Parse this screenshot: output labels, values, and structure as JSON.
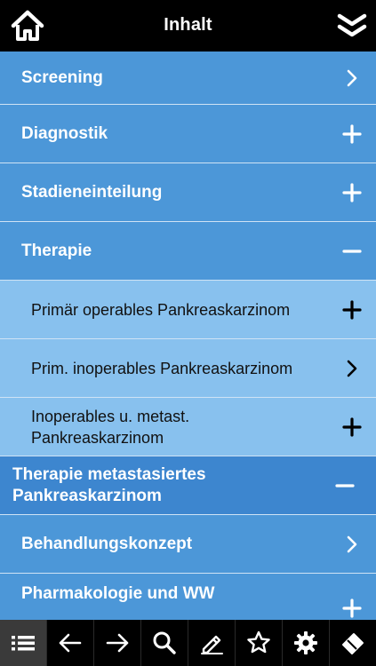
{
  "header": {
    "title": "Inhalt",
    "home_icon": "home-icon",
    "collapse_icon": "double-chevron-down-icon"
  },
  "colors": {
    "level0": "#4c97d8",
    "level1": "#88c1ee",
    "selected": "#3d86cf",
    "bar": "#000000"
  },
  "list": {
    "items": [
      {
        "label": "Screening",
        "control": "chevron-right-icon"
      },
      {
        "label": "Diagnostik",
        "control": "plus-icon"
      },
      {
        "label": "Stadieneinteilung",
        "control": "plus-icon"
      },
      {
        "label": "Therapie",
        "control": "minus-icon",
        "expanded": true
      },
      {
        "label": "Primär operables Pankreaskarzinom",
        "control": "plus-icon"
      },
      {
        "label": "Prim. inoperables Pankreaskarzinom",
        "control": "chevron-right-icon"
      },
      {
        "label_line1": "Inoperables u. metast.",
        "label_line2": "Pankreaskarzinom",
        "control": "plus-icon"
      },
      {
        "label_line1": "Therapie metastasiertes",
        "label_line2": "Pankreaskarzinom",
        "control": "minus-icon",
        "selected": true
      },
      {
        "label": "Behandlungskonzept",
        "control": "chevron-right-icon"
      },
      {
        "label": "Pharmakologie und WW",
        "control": "plus-icon"
      }
    ]
  },
  "toolbar": {
    "buttons": [
      {
        "icon": "list-icon",
        "active": true
      },
      {
        "icon": "arrow-left-icon"
      },
      {
        "icon": "arrow-right-icon"
      },
      {
        "icon": "search-icon"
      },
      {
        "icon": "highlighter-icon"
      },
      {
        "icon": "star-icon"
      },
      {
        "icon": "gear-icon"
      },
      {
        "icon": "eraser-icon"
      }
    ]
  }
}
